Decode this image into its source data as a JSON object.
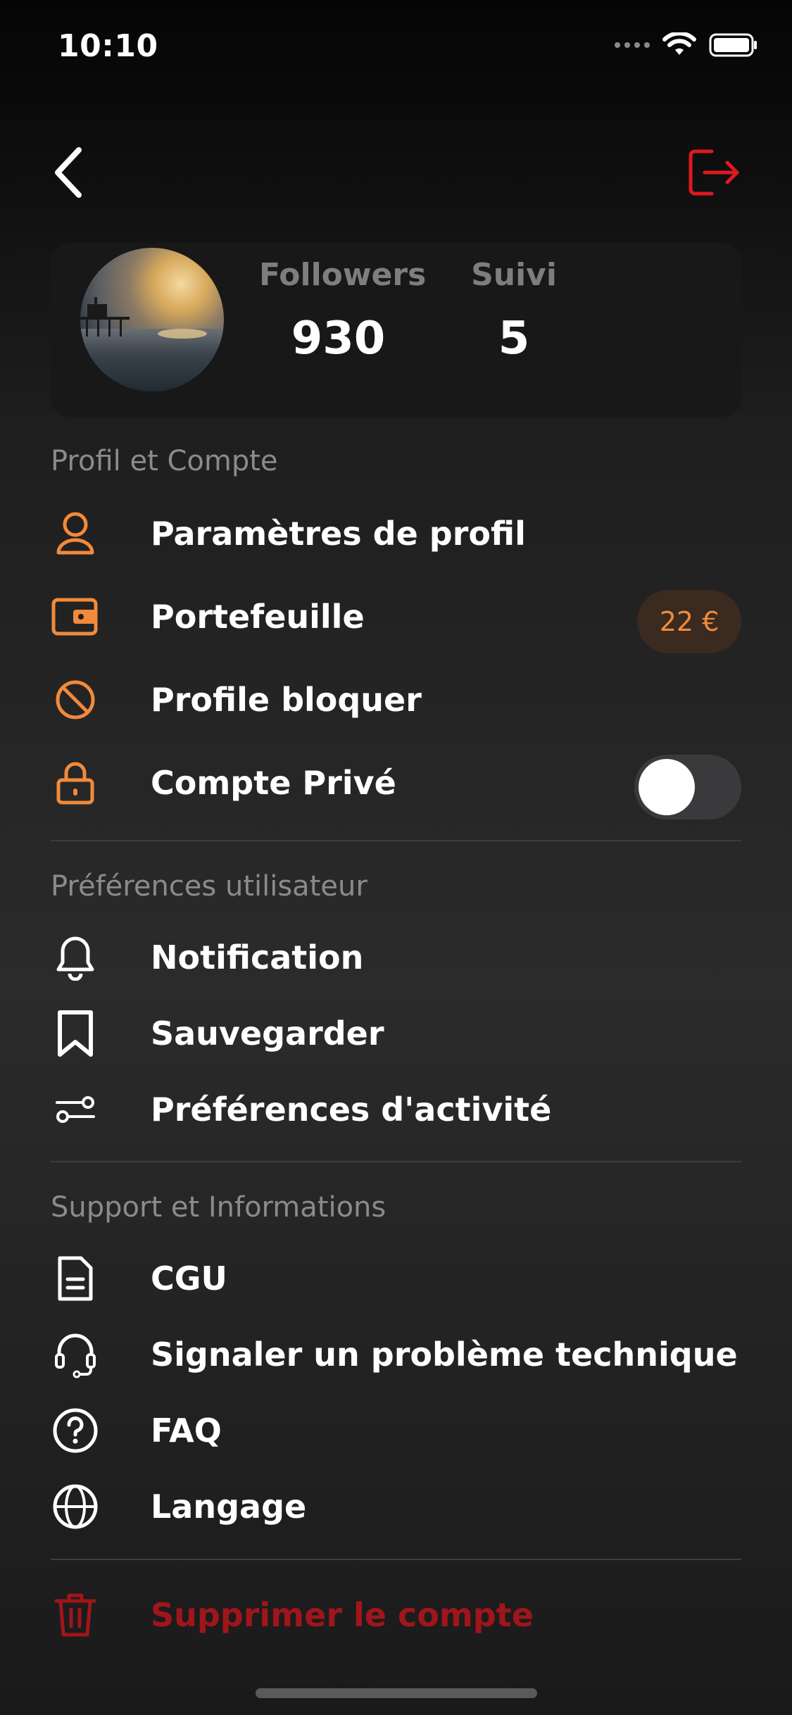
{
  "status_bar": {
    "time": "10:10"
  },
  "profile": {
    "stats": [
      {
        "label": "Followers",
        "value": "930"
      },
      {
        "label": "Suivi",
        "value": "5"
      }
    ]
  },
  "sections": {
    "account": {
      "title": "Profil et Compte",
      "items": [
        {
          "label": "Paramètres de profil",
          "icon": "user-icon"
        },
        {
          "label": "Portefeuille",
          "icon": "wallet-icon",
          "badge": "22 €"
        },
        {
          "label": "Profile bloquer",
          "icon": "block-icon"
        },
        {
          "label": "Compte Privé",
          "icon": "lock-icon",
          "toggle_on": false
        }
      ]
    },
    "preferences": {
      "title": "Préférences utilisateur",
      "items": [
        {
          "label": "Notification",
          "icon": "bell-icon"
        },
        {
          "label": "Sauvegarder",
          "icon": "bookmark-icon"
        },
        {
          "label": "Préférences d'activité",
          "icon": "sliders-icon"
        }
      ]
    },
    "support": {
      "title": "Support et Informations",
      "items": [
        {
          "label": "CGU",
          "icon": "document-icon"
        },
        {
          "label": "Signaler un problème technique",
          "icon": "headset-icon"
        },
        {
          "label": "FAQ",
          "icon": "help-icon"
        },
        {
          "label": "Langage",
          "icon": "globe-icon"
        }
      ]
    }
  },
  "delete_account": {
    "label": "Supprimer le compte",
    "icon": "trash-icon"
  },
  "colors": {
    "accent": "#f28a3a",
    "danger": "#e0191f",
    "delete_text": "#a0151b",
    "background": "#1e1e1e"
  }
}
